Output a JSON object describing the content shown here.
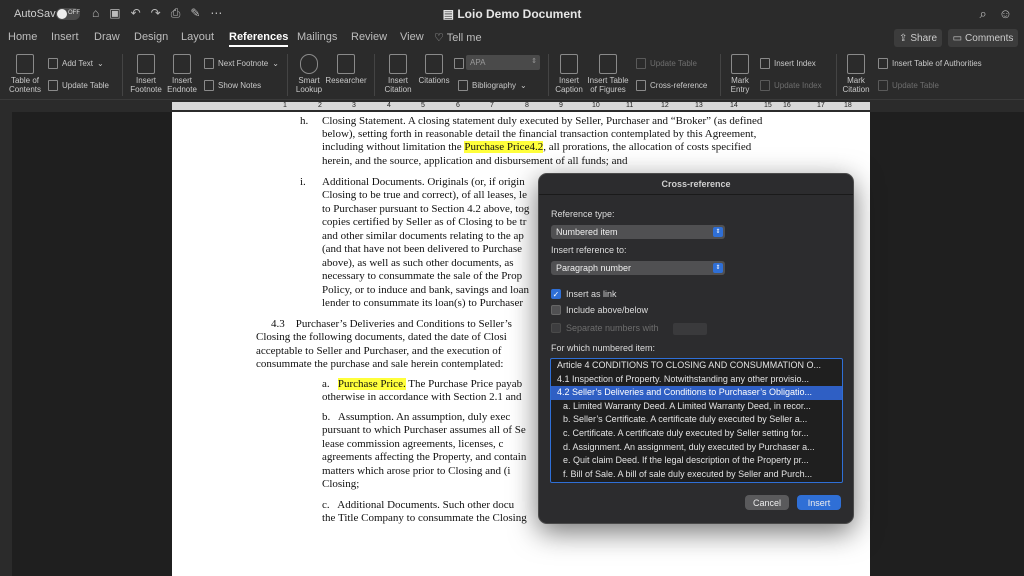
{
  "titlebar": {
    "autosave_label": "AutoSave",
    "toggle_state": "OFF",
    "doc_title": "Loio Demo Document"
  },
  "tabs": [
    "Home",
    "Insert",
    "Draw",
    "Design",
    "Layout",
    "References",
    "Mailings",
    "Review",
    "View",
    "Tell me"
  ],
  "active_tab": "References",
  "share_label": "Share",
  "comments_label": "Comments",
  "ribbon": {
    "toc": "Table of\nContents",
    "add_text": "Add Text",
    "update_table": "Update Table",
    "insert_footnote": "Insert\nFootnote",
    "insert_endnote": "Insert\nEndnote",
    "next_footnote": "Next Footnote",
    "show_notes": "Show Notes",
    "smart_lookup": "Smart\nLookup",
    "researcher": "Researcher",
    "insert_citation": "Insert\nCitation",
    "citations": "Citations",
    "style_value": "APA",
    "bibliography": "Bibliography",
    "insert_caption": "Insert\nCaption",
    "insert_table_of_figures": "Insert Table\nof Figures",
    "update_table2": "Update Table",
    "cross_reference": "Cross-reference",
    "mark_entry": "Mark\nEntry",
    "insert_index": "Insert Index",
    "update_index": "Update Index",
    "mark_citation": "Mark\nCitation",
    "insert_toa": "Insert Table of Authorities",
    "update_table3": "Update Table"
  },
  "ruler_numbers": [
    "1",
    "2",
    "3",
    "4",
    "5",
    "6",
    "7",
    "8",
    "9",
    "10",
    "11",
    "12",
    "13",
    "14",
    "15",
    "16",
    "17",
    "18"
  ],
  "document": {
    "h_marker": "h.",
    "h_text_1": "Closing Statement. A closing statement duly executed by Seller, Purchaser and “Broker” (as defined",
    "h_text_2": "below), setting forth in reasonable detail the financial transaction contemplated by this Agreement,",
    "h_text_3a": "including without limitation the ",
    "h_text_3hl": "Purchase Price4.2",
    "h_text_3b": ", all prorations, the allocation of costs specified",
    "h_text_4": "herein, and the source, application and disbursement of all funds; and",
    "i_marker": "i.",
    "i_lines": [
      "Additional Documents. Originals (or, if origin",
      "Closing to be true and correct), of all leases, le",
      "to Purchaser pursuant to Section 4.2 above, tog",
      "copies certified by Seller as of Closing to be tr",
      "and other similar documents relating to the ap",
      "(and that have not been delivered to Purchase",
      "above), as well as such other documents, as",
      "necessary to consummate the sale of the Prop",
      "Policy, or to induce and bank, savings and loan",
      "lender to consummate its loan(s) to Purchaser"
    ],
    "s43_lines": [
      "4.3    Purchaser’s Deliveries and Conditions to Seller’s",
      "Closing the following documents, dated the date of Closi",
      "acceptable to Seller and Purchaser, and the execution of",
      "consummate the purchase and sale herein contemplated:"
    ],
    "a_marker": "a.",
    "a_hl": "Purchase Price.",
    "a_rest": " The Purchase Price payab",
    "a_line2": "otherwise in accordance with Section 2.1 and",
    "b_lines": [
      "b.   Assumption. An assumption, duly exec",
      "pursuant to which Purchaser assumes all of Se",
      "lease commission agreements, licenses, c",
      "agreements affecting the Property, and contain",
      "matters which arose prior to Closing and (i",
      "Closing;"
    ],
    "c_lines": [
      "c.   Additional Documents. Such other docu",
      "the Title Company to consummate the Closing"
    ]
  },
  "dialog": {
    "title": "Cross-reference",
    "reference_type_label": "Reference type:",
    "reference_type_value": "Numbered item",
    "insert_reference_label": "Insert reference to:",
    "insert_reference_value": "Paragraph number",
    "insert_as_link": "Insert as link",
    "insert_as_link_checked": true,
    "include_above_below": "Include above/below",
    "include_above_below_checked": false,
    "separate_numbers": "Separate numbers with",
    "list_label": "For which numbered item:",
    "items": [
      "Article 4 CONDITIONS TO CLOSING AND CONSUMMATION O...",
      "4.1 Inspection of Property. Notwithstanding any other provisio...",
      "4.2 Seller’s Deliveries and Conditions to Purchaser’s Obligatio...",
      "a. Limited Warranty Deed. A Limited Warranty Deed, in recor...",
      "b. Seller’s Certificate. A certificate duly executed by Seller a...",
      "c. Certificate. A certificate duly executed by Seller setting for...",
      "d. Assignment. An assignment, duly executed by Purchaser a...",
      "e. Quit claim Deed. If the legal description of the Property pr...",
      "f. Bill of Sale. A bill of sale duly executed by Seller and Purch..."
    ],
    "selected_index": 2,
    "cancel_label": "Cancel",
    "insert_label": "Insert"
  }
}
